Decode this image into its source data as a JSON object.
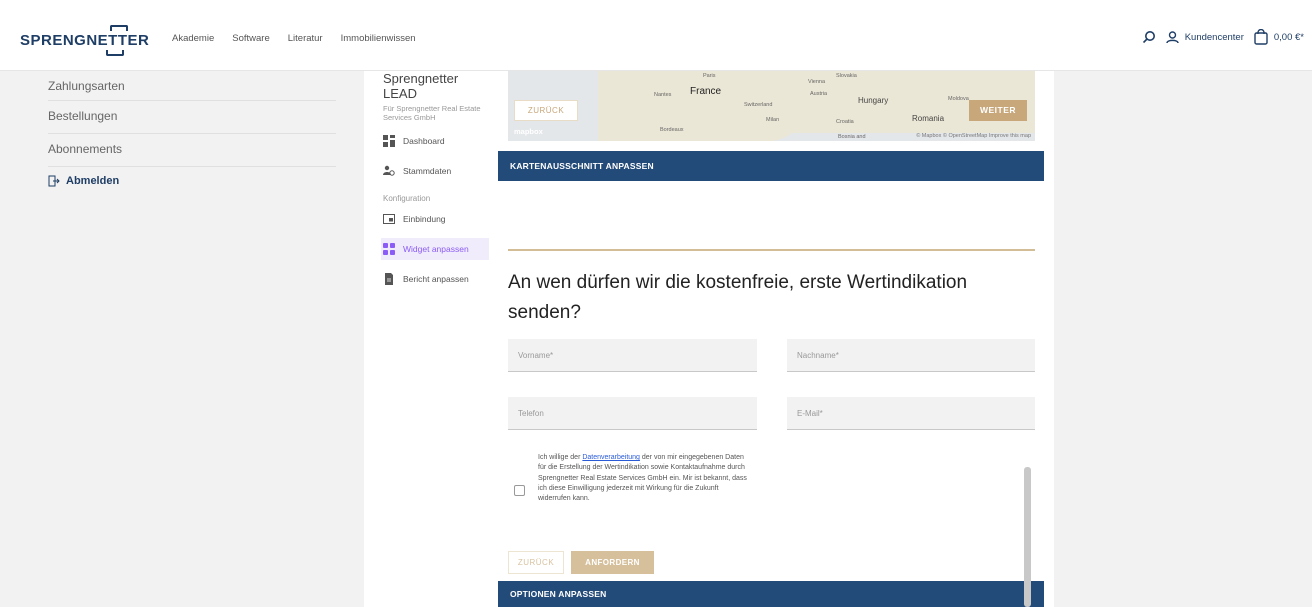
{
  "header": {
    "brand": "SPRENGNETTER",
    "nav": [
      "Akademie",
      "Software",
      "Literatur",
      "Immobilienwissen"
    ],
    "customer_center": "Kundencenter",
    "cart_total": "0,00 €*"
  },
  "account_nav": {
    "items": [
      "Zahlungsarten",
      "Bestellungen",
      "Abonnements"
    ],
    "logout": "Abmelden"
  },
  "product_nav": {
    "title": "Sprengnetter LEAD",
    "subtitle": "Für Sprengnetter Real Estate Services GmbH",
    "dashboard": "Dashboard",
    "master_data": "Stammdaten",
    "config_group": "Konfiguration",
    "embedding": "Einbindung",
    "widget": "Widget anpassen",
    "report": "Bericht anpassen",
    "accent": "#8b5cf6"
  },
  "map": {
    "labels": [
      "Paris",
      "France",
      "Nantes",
      "Bordeaux",
      "Switzerland",
      "Milan",
      "Vienna",
      "Slovakia",
      "Austria",
      "Hungary",
      "Moldova",
      "Croatia",
      "Romania",
      "Bosnia and"
    ],
    "back": "ZURÜCK",
    "next": "WEITER",
    "logo": "mapbox",
    "attribution": "© Mapbox © OpenStreetMap Improve this map"
  },
  "widget": {
    "map_section": "KARTENAUSSCHNITT ANPASSEN",
    "question": "An wen dürfen wir die kostenfreie, erste Wertindikation senden?",
    "first_name": "Vorname*",
    "last_name": "Nachname*",
    "phone": "Telefon",
    "email": "E-Mail*",
    "consent_before": "Ich willige der ",
    "consent_link": "Datenverarbeitung",
    "consent_after": " der von mir eingegebenen Daten für die Erstellung der Wertindikation sowie Kontaktaufnahme durch Sprengnetter Real Estate Services GmbH ein. Mir ist bekannt, dass ich diese Einwilligung jederzeit mit Wirkung für die Zukunft widerrufen kann.",
    "back": "ZURÜCK",
    "request": "ANFORDERN",
    "options_section": "OPTIONEN ANPASSEN",
    "accent_gold": "#c8a77b",
    "accent_blue": "#234b7a"
  }
}
